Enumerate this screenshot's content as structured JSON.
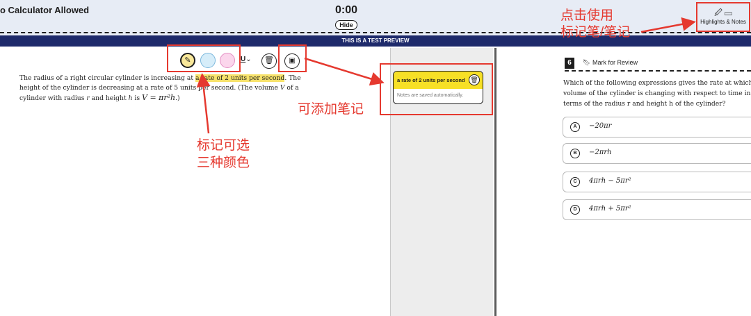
{
  "header": {
    "section_title": "o Calculator Allowed",
    "timer": "0:00",
    "hide_label": "Hide",
    "highlights_notes_label": "Highlights & Notes",
    "highlights_notes_icons": "🖉 ▭"
  },
  "preview_bar": {
    "text": "THIS IS A TEST PREVIEW"
  },
  "toolbar": {
    "highlight_colors": [
      "yellow",
      "blue",
      "pink"
    ],
    "underline_label": "U",
    "icons": [
      "highlighter-icon",
      "underline-icon",
      "trash-icon",
      "note-icon"
    ]
  },
  "passage": {
    "before": "The radius of a right circular cylinder is increasing at ",
    "highlight": "a rate of 2 units per second",
    "after_1": ". The height of the cylinder is decreasing at a rate of 5 units per second. (The volume ",
    "var_v": "V",
    "after_2": " of a cylinder with radius ",
    "var_r": "r",
    "after_3": " and height ",
    "var_h": "h",
    "after_4": " is ",
    "formula": "V = πr²h",
    "after_5": ".)"
  },
  "note_card": {
    "title": "a rate of 2 units per second",
    "body": "Notes are saved automatically."
  },
  "question": {
    "number": "6",
    "mark_review": "Mark for Review",
    "lines": [
      "Which of the following expressions gives the rate at which",
      "volume of the cylinder is changing with respect to time in",
      "terms of the radius r and height h of the cylinder?"
    ],
    "choices": [
      {
        "letter": "A",
        "text": "−20πr"
      },
      {
        "letter": "B",
        "text": "−2πrh"
      },
      {
        "letter": "C",
        "text": "4πrh − 5πr²"
      },
      {
        "letter": "D",
        "text": "4πrh + 5πr²"
      }
    ]
  },
  "annotations": {
    "top_right_line1": "点击使用",
    "top_right_line2": "标记笔/笔记",
    "add_notes": "可添加笔记",
    "colors_line1": "标记可选",
    "colors_line2": "三种颜色"
  },
  "colors": {
    "annotation_red": "#e5392f",
    "highlight_yellow": "#f7e26b",
    "preview_navy": "#1e2a6b"
  }
}
